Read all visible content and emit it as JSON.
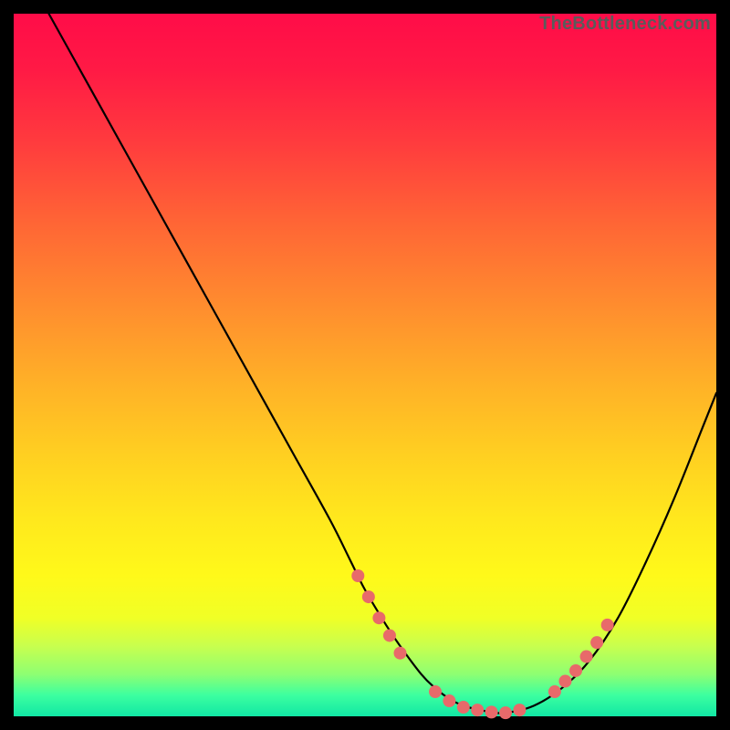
{
  "watermark": "TheBottleneck.com",
  "chart_data": {
    "type": "line",
    "title": "",
    "xlabel": "",
    "ylabel": "",
    "xlim": [
      0,
      100
    ],
    "ylim": [
      0,
      100
    ],
    "series": [
      {
        "name": "curve",
        "x": [
          5,
          10,
          15,
          20,
          25,
          30,
          35,
          40,
          45,
          48,
          50,
          53,
          55,
          58,
          60,
          62,
          64,
          66,
          68,
          70,
          74,
          78,
          82,
          86,
          90,
          94,
          98,
          100
        ],
        "y": [
          100,
          91,
          82,
          73,
          64,
          55,
          46,
          37,
          28,
          22,
          18,
          13,
          10,
          6,
          4,
          2.5,
          1.5,
          1,
          0.6,
          0.5,
          1.5,
          4,
          8,
          14,
          22,
          31,
          41,
          46
        ]
      }
    ],
    "markers": {
      "name": "highlight-points",
      "color": "#e86a6a",
      "radius": 7,
      "points": [
        {
          "x": 49,
          "y": 20
        },
        {
          "x": 50.5,
          "y": 17
        },
        {
          "x": 52,
          "y": 14
        },
        {
          "x": 53.5,
          "y": 11.5
        },
        {
          "x": 55,
          "y": 9
        },
        {
          "x": 60,
          "y": 3.5
        },
        {
          "x": 62,
          "y": 2.2
        },
        {
          "x": 64,
          "y": 1.3
        },
        {
          "x": 66,
          "y": 0.9
        },
        {
          "x": 68,
          "y": 0.6
        },
        {
          "x": 70,
          "y": 0.5
        },
        {
          "x": 72,
          "y": 0.9
        },
        {
          "x": 77,
          "y": 3.5
        },
        {
          "x": 78.5,
          "y": 5
        },
        {
          "x": 80,
          "y": 6.5
        },
        {
          "x": 81.5,
          "y": 8.5
        },
        {
          "x": 83,
          "y": 10.5
        },
        {
          "x": 84.5,
          "y": 13
        }
      ]
    }
  }
}
